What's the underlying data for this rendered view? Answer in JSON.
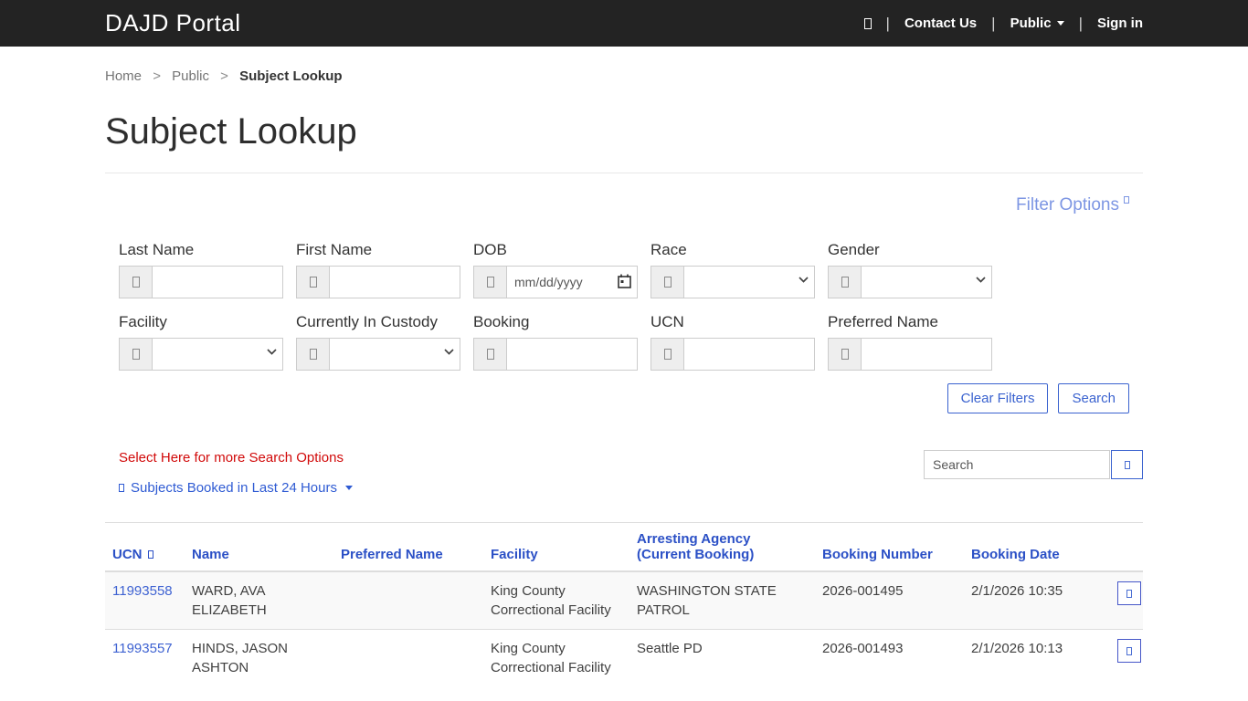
{
  "header": {
    "brand": "DAJD Portal",
    "nav": {
      "contact": "Contact Us",
      "public": "Public",
      "sign_in": "Sign in"
    }
  },
  "breadcrumb": {
    "home": "Home",
    "public": "Public",
    "current": "Subject Lookup",
    "separator": ">"
  },
  "page": {
    "title": "Subject Lookup"
  },
  "filters": {
    "options_label": "Filter Options",
    "fields": [
      {
        "label": "Last Name",
        "type": "text",
        "value": ""
      },
      {
        "label": "First Name",
        "type": "text",
        "value": ""
      },
      {
        "label": "DOB",
        "type": "date",
        "placeholder": "mm/dd/yyyy",
        "value": ""
      },
      {
        "label": "Race",
        "type": "select",
        "selected": ""
      },
      {
        "label": "Gender",
        "type": "select",
        "selected": ""
      },
      {
        "label": "Facility",
        "type": "select",
        "selected": ""
      },
      {
        "label": "Currently In Custody",
        "type": "select",
        "selected": ""
      },
      {
        "label": "Booking",
        "type": "text",
        "value": ""
      },
      {
        "label": "UCN",
        "type": "text",
        "value": ""
      },
      {
        "label": "Preferred Name",
        "type": "text",
        "value": ""
      }
    ],
    "clear_label": "Clear Filters",
    "search_label": "Search"
  },
  "list_controls": {
    "more_options": "Select Here for more Search Options",
    "booked_toggle": "Subjects Booked in Last 24 Hours",
    "search_placeholder": "Search"
  },
  "results": {
    "columns": {
      "ucn": "UCN",
      "name": "Name",
      "preferred_name": "Preferred Name",
      "facility": "Facility",
      "arresting_agency": "Arresting Agency (Current Booking)",
      "booking_number": "Booking Number",
      "booking_date": "Booking Date"
    },
    "rows": [
      {
        "ucn": "11993558",
        "name": "WARD, AVA ELIZABETH",
        "preferred_name": "",
        "facility": "King County Correctional Facility",
        "arresting_agency": "WASHINGTON STATE PATROL",
        "booking_number": "2026-001495",
        "booking_date": "2/1/2026 10:35"
      },
      {
        "ucn": "11993557",
        "name": "HINDS, JASON ASHTON",
        "preferred_name": "",
        "facility": "King County Correctional Facility",
        "arresting_agency": "Seattle PD",
        "booking_number": "2026-001493",
        "booking_date": "2/1/2026 10:13"
      }
    ]
  },
  "colors": {
    "navbar_bg": "#232323",
    "primary_blue": "#2b50c6",
    "button_blue": "#3a62cf",
    "link_blue": "#3f63d2",
    "light_blue": "#7d96e3",
    "alert_red": "#d10a0a",
    "stripe": "#f9f9f9",
    "border": "#cccccc"
  }
}
